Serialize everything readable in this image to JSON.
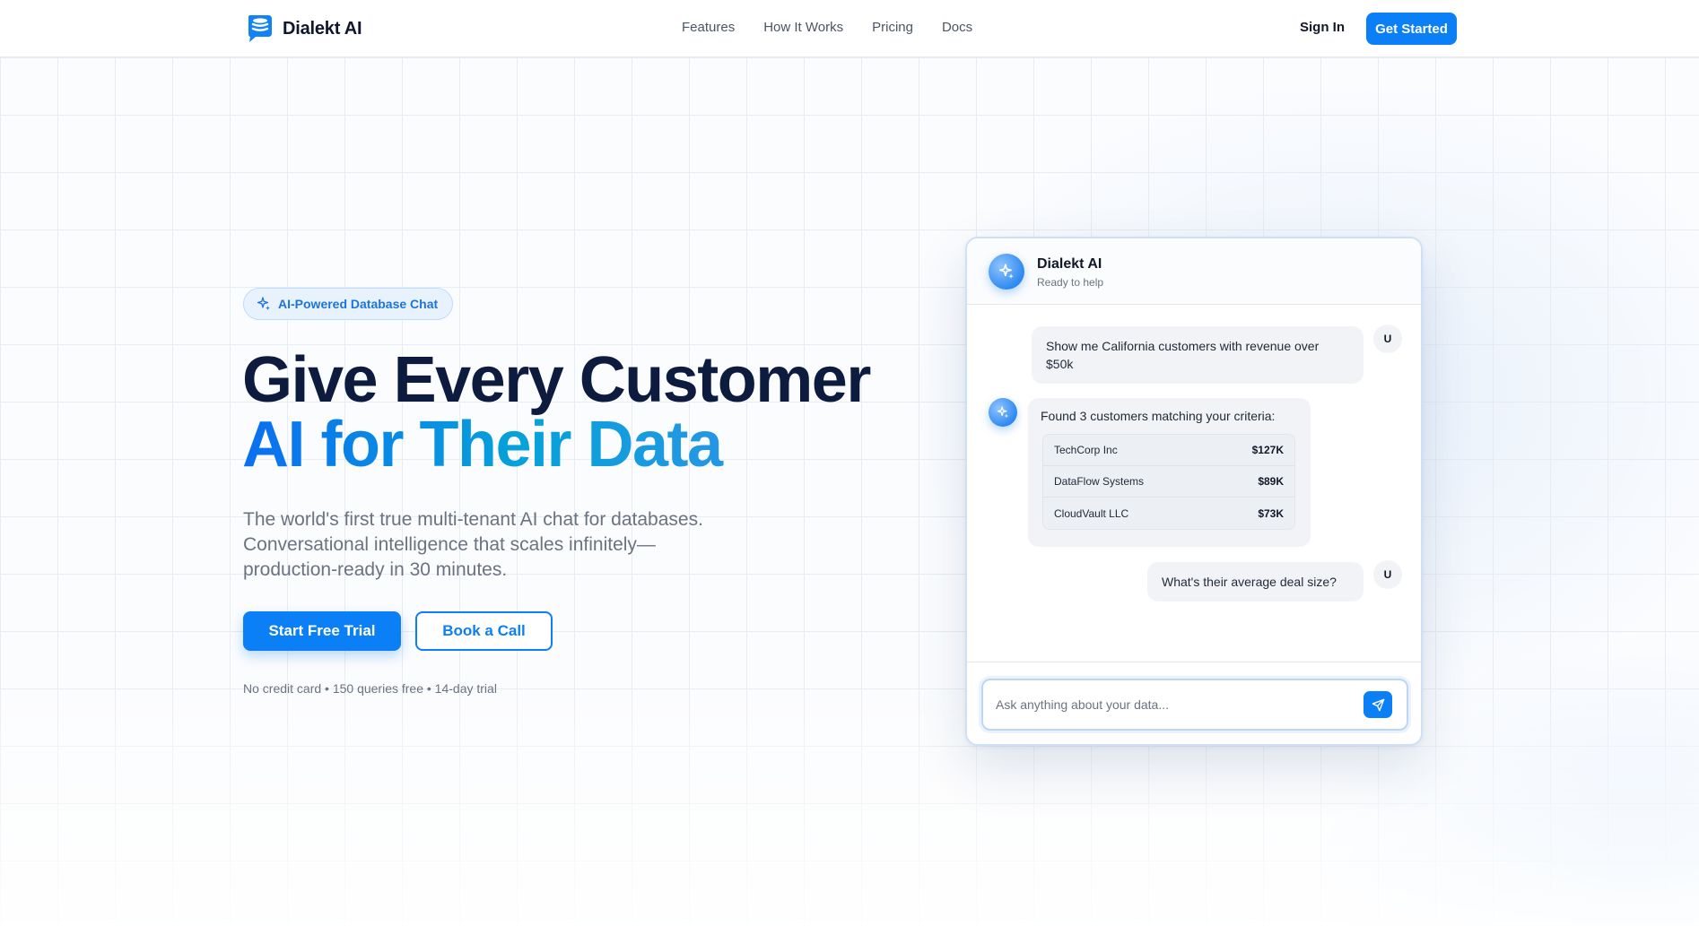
{
  "header": {
    "brand": "Dialekt AI",
    "nav": [
      "Features",
      "How It Works",
      "Pricing",
      "Docs"
    ],
    "sign_in": "Sign In",
    "get_started": "Get Started"
  },
  "hero": {
    "badge": "AI-Powered Database Chat",
    "headline_line1": "Give Every Customer",
    "headline_line2": "AI for Their Data",
    "subtext": "The world's first true multi-tenant AI chat for databases. Conversational intelligence that scales infinitely—production-ready in 30 minutes.",
    "primary_cta": "Start Free Trial",
    "secondary_cta": "Book a Call",
    "fineprint": "No credit card • 150 queries free • 14-day trial"
  },
  "chat": {
    "title": "Dialekt AI",
    "status": "Ready to help",
    "user_avatar_letter": "U",
    "messages": {
      "user_1": "Show me California customers with revenue over $50k",
      "bot_1": "Found 3 customers matching your criteria:",
      "results": [
        {
          "name": "TechCorp Inc",
          "amount": "$127K"
        },
        {
          "name": "DataFlow Systems",
          "amount": "$89K"
        },
        {
          "name": "CloudVault LLC",
          "amount": "$73K"
        }
      ],
      "user_2": "What's their average deal size?"
    },
    "input_placeholder": "Ask anything about your data..."
  },
  "colors": {
    "primary": "#0b7ff5",
    "headline_dark": "#0d1b3e",
    "gradient_start": "#0b6ff0",
    "gradient_mid": "#06a2d9",
    "badge_bg": "#e8f2fd"
  },
  "icons": {
    "logo": "database-chat-logo-icon",
    "badge": "sparkle-icon",
    "bot": "sparkle-icon",
    "send": "send-icon"
  }
}
